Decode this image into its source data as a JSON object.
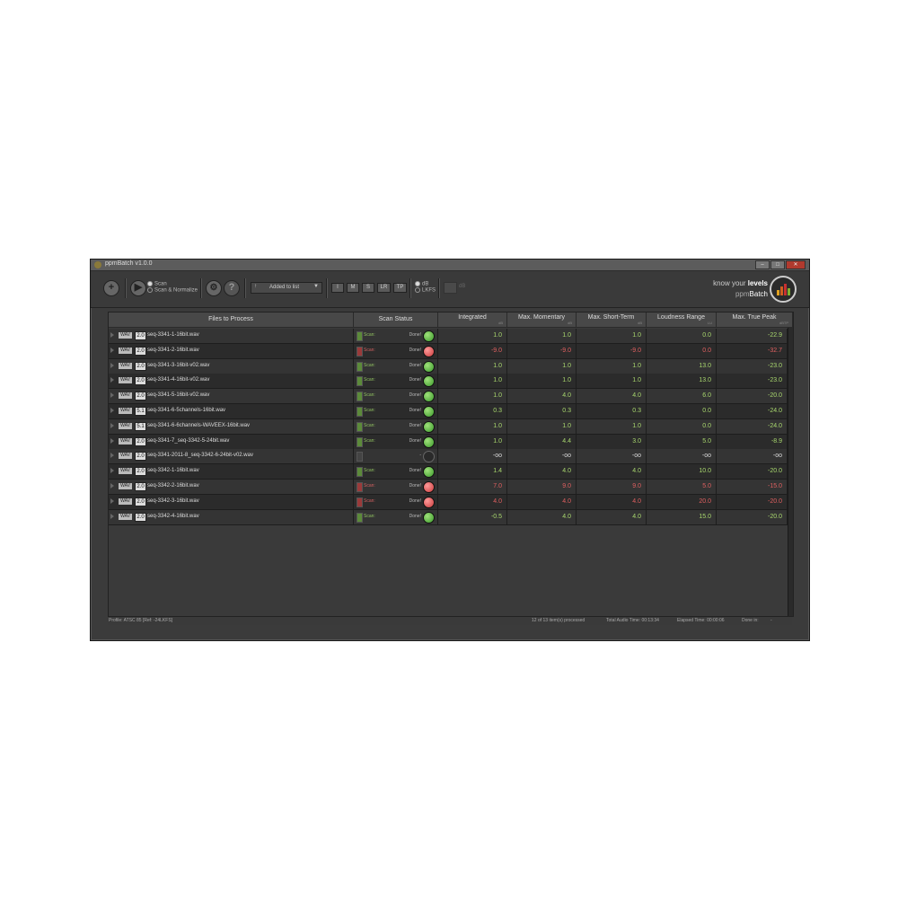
{
  "window": {
    "title": "ppmBatch  v1.0.0"
  },
  "window_controls": {
    "minimize": "–",
    "maximize": "□",
    "close": "✕"
  },
  "toolbar": {
    "add_icon": "plus-icon",
    "play_icon": "play-icon",
    "mode_options": [
      {
        "label": "Scan",
        "selected": true
      },
      {
        "label": "Scan & Normalize",
        "selected": false
      }
    ],
    "sort": {
      "value": "Added to list",
      "arrow": "↑",
      "dropdown": "▼"
    },
    "metric_buttons": [
      "I",
      "M",
      "S",
      "LR",
      "TP"
    ],
    "unit_options": [
      {
        "label": "dB",
        "selected": true
      },
      {
        "label": "LKFS",
        "selected": false
      }
    ],
    "unit_label": "dB",
    "settings_glyph": "⚙",
    "help_glyph": "?"
  },
  "brand": {
    "line1_prefix": "know your ",
    "line1_bold": "levels",
    "line2_prefix": "ppm",
    "line2_bold": "Batch"
  },
  "columns": [
    {
      "label": "Files to Process",
      "unit": ""
    },
    {
      "label": "Scan Status",
      "unit": ""
    },
    {
      "label": "Integrated",
      "unit": "dB"
    },
    {
      "label": "Max. Momentary",
      "unit": "dB"
    },
    {
      "label": "Max. Short-Term",
      "unit": "dB"
    },
    {
      "label": "Loudness Range",
      "unit": "LU"
    },
    {
      "label": "Max. True Peak",
      "unit": "dBTP"
    }
  ],
  "rows": [
    {
      "fmt": "WAV",
      "ch": "2.0",
      "file": "seq-3341-1-16bit.wav",
      "scan_label": "Scan:",
      "status": "Done!",
      "result": "ok",
      "integrated": "1.0",
      "momentary": "1.0",
      "short_term": "1.0",
      "lra": "0.0",
      "true_peak": "-22.9",
      "color": "g"
    },
    {
      "fmt": "WAV",
      "ch": "2.0",
      "file": "seq-3341-2-16bit.wav",
      "scan_label": "Scan:",
      "status": "Done!",
      "result": "bad",
      "integrated": "-9.0",
      "momentary": "-9.0",
      "short_term": "-9.0",
      "lra": "0.0",
      "true_peak": "-32.7",
      "color": "r"
    },
    {
      "fmt": "WAV",
      "ch": "2.0",
      "file": "seq-3341-3-16bit-v02.wav",
      "scan_label": "Scan:",
      "status": "Done!",
      "result": "ok",
      "integrated": "1.0",
      "momentary": "1.0",
      "short_term": "1.0",
      "lra": "13.0",
      "true_peak": "-23.0",
      "color": "g"
    },
    {
      "fmt": "WAV",
      "ch": "2.0",
      "file": "seq-3341-4-16bit-v02.wav",
      "scan_label": "Scan:",
      "status": "Done!",
      "result": "ok",
      "integrated": "1.0",
      "momentary": "1.0",
      "short_term": "1.0",
      "lra": "13.0",
      "true_peak": "-23.0",
      "color": "g"
    },
    {
      "fmt": "WAV",
      "ch": "2.0",
      "file": "seq-3341-5-16bit-v02.wav",
      "scan_label": "Scan:",
      "status": "Done!",
      "result": "ok",
      "integrated": "1.0",
      "momentary": "4.0",
      "short_term": "4.0",
      "lra": "6.0",
      "true_peak": "-20.0",
      "color": "g"
    },
    {
      "fmt": "WAV",
      "ch": "5.1",
      "file": "seq-3341-6-5channels-16bit.wav",
      "scan_label": "Scan:",
      "status": "Done!",
      "result": "ok",
      "integrated": "0.3",
      "momentary": "0.3",
      "short_term": "0.3",
      "lra": "0.0",
      "true_peak": "-24.0",
      "color": "g"
    },
    {
      "fmt": "WAV",
      "ch": "5.1",
      "file": "seq-3341-6-6channels-WAVEEX-16bit.wav",
      "scan_label": "Scan:",
      "status": "Done!",
      "result": "ok",
      "integrated": "1.0",
      "momentary": "1.0",
      "short_term": "1.0",
      "lra": "0.0",
      "true_peak": "-24.0",
      "color": "g"
    },
    {
      "fmt": "WAV",
      "ch": "2.0",
      "file": "seq-3341-7_seq-3342-5-24bit.wav",
      "scan_label": "Scan:",
      "status": "Done!",
      "result": "ok",
      "integrated": "1.0",
      "momentary": "4.4",
      "short_term": "3.0",
      "lra": "5.0",
      "true_peak": "-8.9",
      "color": "g"
    },
    {
      "fmt": "WAV",
      "ch": "2.0",
      "file": "seq-3341-2011-8_seq-3342-6-24bit-v02.wav",
      "scan_label": "",
      "status": "-",
      "result": "none",
      "integrated": "-oo",
      "momentary": "-oo",
      "short_term": "-oo",
      "lra": "-oo",
      "true_peak": "-oo",
      "color": "w"
    },
    {
      "fmt": "WAV",
      "ch": "2.0",
      "file": "seq-3342-1-16bit.wav",
      "scan_label": "Scan:",
      "status": "Done!",
      "result": "ok",
      "integrated": "1.4",
      "momentary": "4.0",
      "short_term": "4.0",
      "lra": "10.0",
      "true_peak": "-20.0",
      "color": "g"
    },
    {
      "fmt": "WAV",
      "ch": "2.0",
      "file": "seq-3342-2-16bit.wav",
      "scan_label": "Scan:",
      "status": "Done!",
      "result": "bad",
      "integrated": "7.0",
      "momentary": "9.0",
      "short_term": "9.0",
      "lra": "5.0",
      "true_peak": "-15.0",
      "color": "r"
    },
    {
      "fmt": "WAV",
      "ch": "2.0",
      "file": "seq-3342-3-16bit.wav",
      "scan_label": "Scan:",
      "status": "Done!",
      "result": "bad",
      "integrated": "4.0",
      "momentary": "4.0",
      "short_term": "4.0",
      "lra": "20.0",
      "true_peak": "-20.0",
      "color": "r"
    },
    {
      "fmt": "WAV",
      "ch": "2.0",
      "file": "seq-3342-4-16bit.wav",
      "scan_label": "Scan:",
      "status": "Done!",
      "result": "ok",
      "integrated": "-0.5",
      "momentary": "4.0",
      "short_term": "4.0",
      "lra": "15.0",
      "true_peak": "-20.0",
      "color": "g"
    }
  ],
  "status_bar": {
    "profile": "Profile: ATSC 85 [Ref: -24LKFS]",
    "processed": "12 of 13 item(s) processed",
    "total_audio": "Total Audio Time: 00:13:34",
    "elapsed": "Elapsed Time: 00:00:06",
    "done_in": "Done in:",
    "done_value": "-"
  }
}
